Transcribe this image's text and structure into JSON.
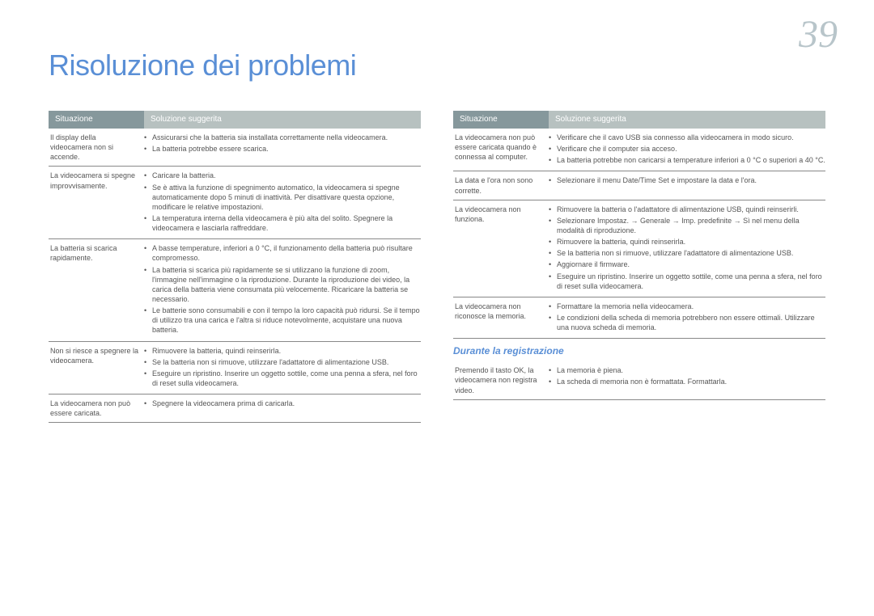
{
  "page_number": "39",
  "title": "Risoluzione dei problemi",
  "headers": {
    "situazione": "Situazione",
    "soluzione": "Soluzione suggerita"
  },
  "col1": {
    "rows": [
      {
        "situation": "Il display della videocamera non si accende.",
        "items": [
          "Assicurarsi che la batteria sia installata correttamente nella videocamera.",
          "La batteria potrebbe essere scarica."
        ]
      },
      {
        "situation": "La videocamera si spegne improvvisamente.",
        "items": [
          "Caricare la batteria.",
          "Se è attiva la funzione di spegnimento automatico, la videocamera si spegne automaticamente dopo 5 minuti di inattività. Per disattivare questa opzione, modificare le relative impostazioni.",
          "La temperatura interna della videocamera è più alta del solito. Spegnere la videocamera e lasciarla raffreddare."
        ]
      },
      {
        "situation": "La batteria si scarica rapidamente.",
        "items": [
          "A basse temperature, inferiori a 0 °C, il funzionamento della batteria può risultare compromesso.",
          "La batteria si scarica più rapidamente se si utilizzano la funzione di zoom, l'immagine nell'immagine o la riproduzione. Durante la riproduzione dei video, la carica della batteria viene consumata più velocemente. Ricaricare la batteria se necessario.",
          "Le batterie sono consumabili e con il tempo la loro capacità può ridursi. Se il tempo di utilizzo tra una carica e l'altra si riduce notevolmente, acquistare una nuova batteria."
        ]
      },
      {
        "situation": "Non si riesce a spegnere la videocamera.",
        "items": [
          "Rimuovere la batteria, quindi reinserirla.",
          "Se la batteria non si rimuove, utilizzare l'adattatore di alimentazione USB.",
          "Eseguire un ripristino. Inserire un oggetto sottile, come una penna a sfera, nel foro di reset sulla videocamera."
        ]
      },
      {
        "situation": "La videocamera non può essere caricata.",
        "items": [
          "Spegnere la videocamera prima di caricarla."
        ]
      }
    ]
  },
  "col2": {
    "top_rows": [
      {
        "situation": "La videocamera non può essere caricata quando è connessa al computer.",
        "items": [
          "Verificare che il cavo USB sia connesso alla videocamera in modo sicuro.",
          "Verificare che il computer sia acceso.",
          "La batteria potrebbe non caricarsi a temperature inferiori a 0 °C o superiori a 40 °C."
        ]
      },
      {
        "situation": "La data e l'ora non sono corrette.",
        "items": [
          "Selezionare il menu Date/Time Set e impostare la data e l'ora."
        ]
      },
      {
        "situation": "La videocamera non funziona.",
        "items": [
          "Rimuovere la batteria o l'adattatore di alimentazione USB, quindi reinserirli.",
          "Selezionare Impostaz. → Generale → Imp. predefinite → Sì nel menu della modalità di riproduzione.",
          "Rimuovere la batteria, quindi reinserirla.",
          "Se la batteria non si rimuove, utilizzare l'adattatore di alimentazione USB.",
          "Aggiornare il firmware.",
          "Eseguire un ripristino. Inserire un oggetto sottile, come una penna a sfera, nel foro di reset sulla videocamera."
        ]
      },
      {
        "situation": "La videocamera non riconosce la memoria.",
        "items": [
          "Formattare la memoria nella videocamera.",
          "Le condizioni della scheda di memoria potrebbero non essere ottimali. Utilizzare una nuova scheda di memoria."
        ]
      }
    ],
    "subtitle": "Durante la registrazione",
    "bottom_rows": [
      {
        "situation": "Premendo il tasto OK, la videocamera non registra video.",
        "items": [
          "La memoria è piena.",
          "La scheda di memoria non è formattata. Formattarla."
        ]
      }
    ]
  }
}
